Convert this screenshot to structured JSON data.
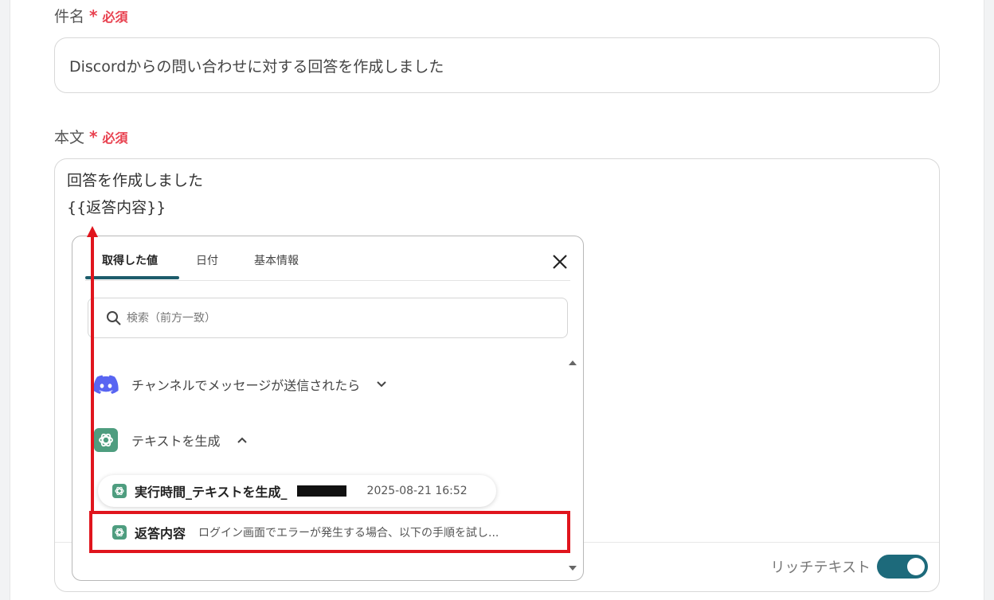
{
  "form": {
    "subject": {
      "label": "件名",
      "required_mark": "*",
      "required_text": "必須",
      "value": "Discordからの問い合わせに対する回答を作成しました"
    },
    "body": {
      "label": "本文",
      "required_mark": "*",
      "required_text": "必須",
      "lines": [
        "回答を作成しました",
        "{{返答内容}}"
      ],
      "rich_text_label": "リッチテキスト",
      "rich_text_enabled": true
    }
  },
  "popup": {
    "tabs": [
      {
        "label": "取得した値",
        "active": true
      },
      {
        "label": "日付",
        "active": false
      },
      {
        "label": "基本情報",
        "active": false
      }
    ],
    "search": {
      "placeholder": "検索（前方一致）"
    },
    "groups": [
      {
        "label": "チャンネルでメッセージが送信されたら",
        "icon": "discord-icon",
        "expanded": false
      },
      {
        "label": "テキストを生成",
        "icon": "openai-icon",
        "expanded": true
      }
    ],
    "items": [
      {
        "name": "実行時間_テキストを生成_",
        "value": "2025-08-21 16:52",
        "icon": "openai-icon"
      },
      {
        "name": "返答内容",
        "value": "ログイン画面でエラーが発生する場合、以下の手順を試し...",
        "icon": "openai-icon"
      }
    ]
  },
  "colors": {
    "required": "#e8414f",
    "toggle": "#1d6a7b",
    "tab_underline": "#1d5c6b",
    "highlight": "#e0151d",
    "discord": "#5865f2",
    "openai": "#4e9d7f"
  }
}
